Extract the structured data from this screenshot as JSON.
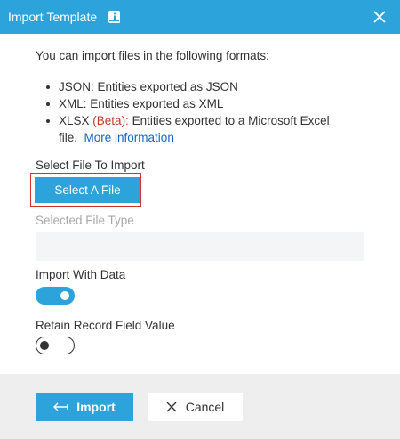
{
  "dialog": {
    "title": "Import Template",
    "intro": "You can import files in the following formats:",
    "formats": [
      {
        "name": "JSON:",
        "desc": "Entities exported as JSON"
      },
      {
        "name": "XML:",
        "desc": "Entities exported as XML"
      },
      {
        "name": "XLSX",
        "beta": "(Beta):",
        "desc": "Entities exported to a Microsoft Excel file.",
        "link": "More information"
      }
    ],
    "select_file_label": "Select File To Import",
    "select_file_button": "Select A File",
    "selected_file_type_label": "Selected File Type",
    "selected_file_type_value": "",
    "import_with_data_label": "Import With Data",
    "import_with_data_on": true,
    "retain_label": "Retain Record Field Value",
    "retain_on": false,
    "import_button": "Import",
    "cancel_button": "Cancel"
  },
  "colors": {
    "header_bg": "#2da3db",
    "accent": "#2da3db",
    "beta_text": "#c0392b",
    "link": "#1565c0",
    "highlight_outline": "#d32f2f",
    "footer_bg": "#eeeeee"
  },
  "icons": {
    "header_info": "info-book-icon",
    "close": "close-icon",
    "import": "arrow-import-icon",
    "cancel": "close-icon"
  }
}
